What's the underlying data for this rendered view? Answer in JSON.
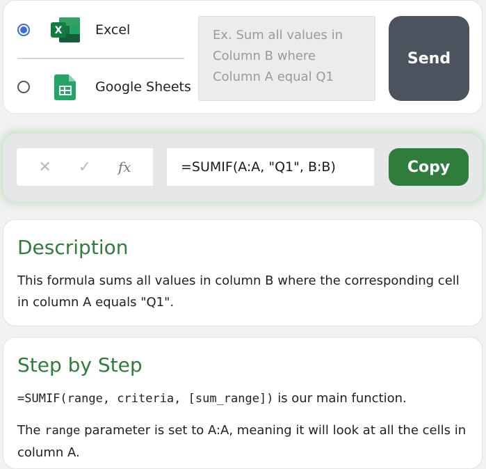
{
  "apps": {
    "excel": {
      "label": "Excel",
      "selected": true
    },
    "sheets": {
      "label": "Google Sheets",
      "selected": false
    }
  },
  "prompt": {
    "placeholder": "Ex. Sum all values in Column B where Column A equal Q1"
  },
  "send_label": "Send",
  "formula": {
    "value": "=SUMIF(A:A, \"Q1\", B:B)",
    "copy_label": "Copy"
  },
  "description": {
    "title": "Description",
    "text": "This formula sums all values in column B where the corresponding cell in column A equals \"Q1\"."
  },
  "steps": {
    "title": "Step by Step",
    "line1_code": "=SUMIF(range, criteria, [sum_range])",
    "line1_text": " is our main function.",
    "line2_pre": "The ",
    "line2_code": "range",
    "line2_text": " parameter is set to A:A, meaning it will look at all the cells in column A."
  },
  "colors": {
    "accent_green": "#2e7d3b",
    "send_bg": "#4d535e",
    "radio_blue": "#3b6fd8"
  }
}
